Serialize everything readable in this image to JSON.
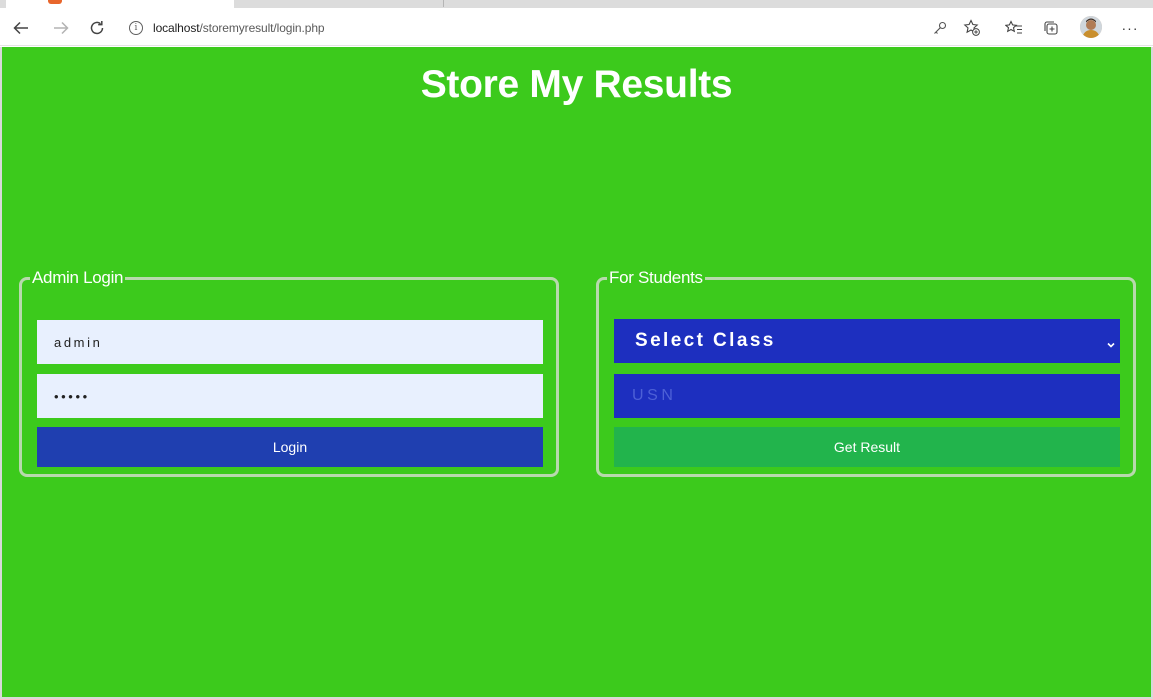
{
  "browser": {
    "url_host": "localhost",
    "url_path": "/storemyresult/login.php",
    "more_label": "···"
  },
  "page": {
    "title": "Store My Results",
    "background_color": "#3cca1c"
  },
  "admin": {
    "legend": "Admin Login",
    "username_value": "admin",
    "password_value": "•••••",
    "login_label": "Login",
    "button_color": "#1f3fb0",
    "input_color": "#e8f0fe"
  },
  "students": {
    "legend": "For Students",
    "select_label": "Select Class",
    "usn_placeholder": "USN",
    "get_result_label": "Get Result",
    "field_color": "#1d2fbf",
    "button_color": "#22b44c"
  }
}
